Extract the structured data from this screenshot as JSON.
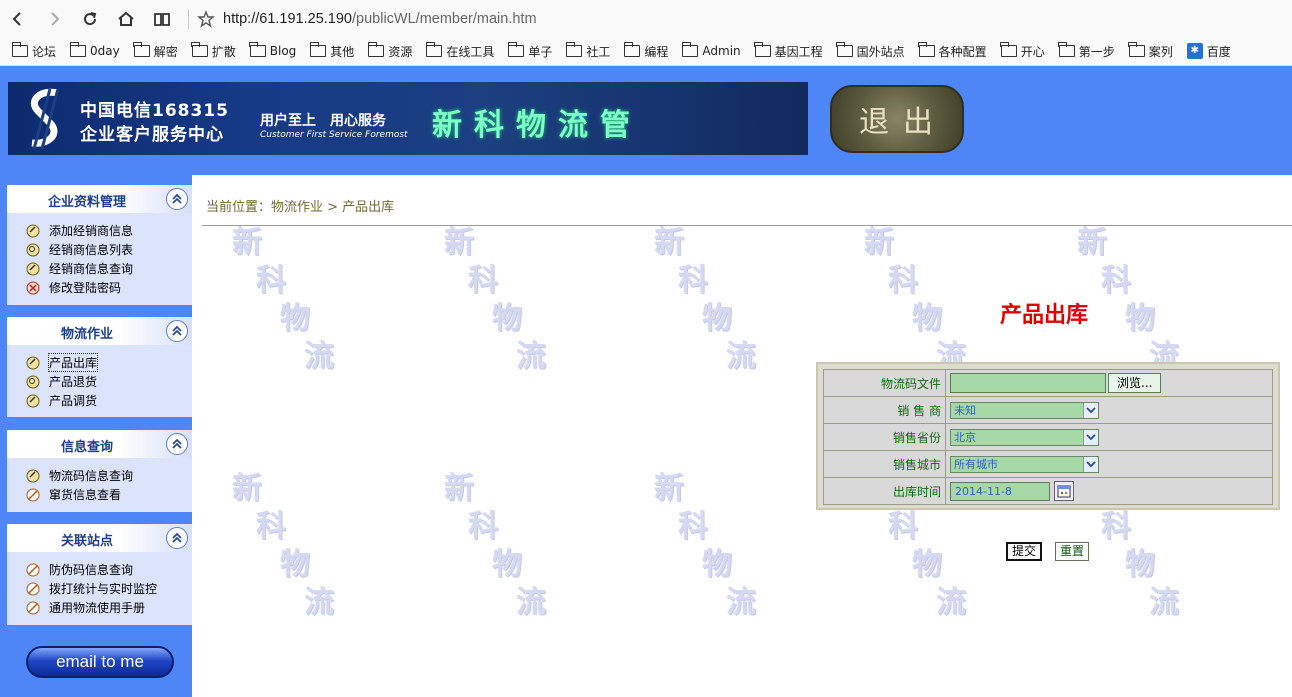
{
  "browser": {
    "url_host": "http://61.191.25.190",
    "url_path": "/publicWL/member/main.htm",
    "bookmarks": [
      "论坛",
      "0day",
      "解密",
      "扩散",
      "Blog",
      "其他",
      "资源",
      "在线工具",
      "单子",
      "社工",
      "编程",
      "Admin",
      "基因工程",
      "国外站点",
      "各种配置",
      "开心",
      "第一步",
      "案列",
      "百度"
    ]
  },
  "banner": {
    "brand_line1": "中国电信168315",
    "brand_line2": "企业客户服务中心",
    "slogan": "用户至上　用心服务",
    "slogan_en": "Customer First Service Foremost",
    "title": "新科物流管",
    "logout_label": "退出"
  },
  "sidebar": {
    "panels": [
      {
        "title": "企业资料管理",
        "items": [
          "添加经销商信息",
          "经销商信息列表",
          "经销商信息查询",
          "修改登陆密码"
        ]
      },
      {
        "title": "物流作业",
        "items": [
          "产品出库",
          "产品退货",
          "产品调货"
        ]
      },
      {
        "title": "信息查询",
        "items": [
          "物流码信息查询",
          "窜货信息查看"
        ]
      },
      {
        "title": "关联站点",
        "items": [
          "防伪码信息查询",
          "拨打统计与实时监控",
          "通用物流使用手册"
        ]
      }
    ],
    "email_label": "email to me"
  },
  "main": {
    "breadcrumb": "当前位置：物流作业 > 产品出库",
    "watermark": [
      "新",
      "科",
      "物",
      "流"
    ],
    "form_title": "产品出库",
    "form": {
      "file_label": "物流码文件",
      "browse_label": "浏览...",
      "dealer_label": "销 售 商",
      "dealer_value": "未知",
      "province_label": "销售省份",
      "province_value": "北京",
      "city_label": "销售城市",
      "city_value": "所有城市",
      "date_label": "出库时间",
      "date_value": "2014-11-8"
    },
    "submit_label": "提交",
    "reset_label": "重置"
  }
}
